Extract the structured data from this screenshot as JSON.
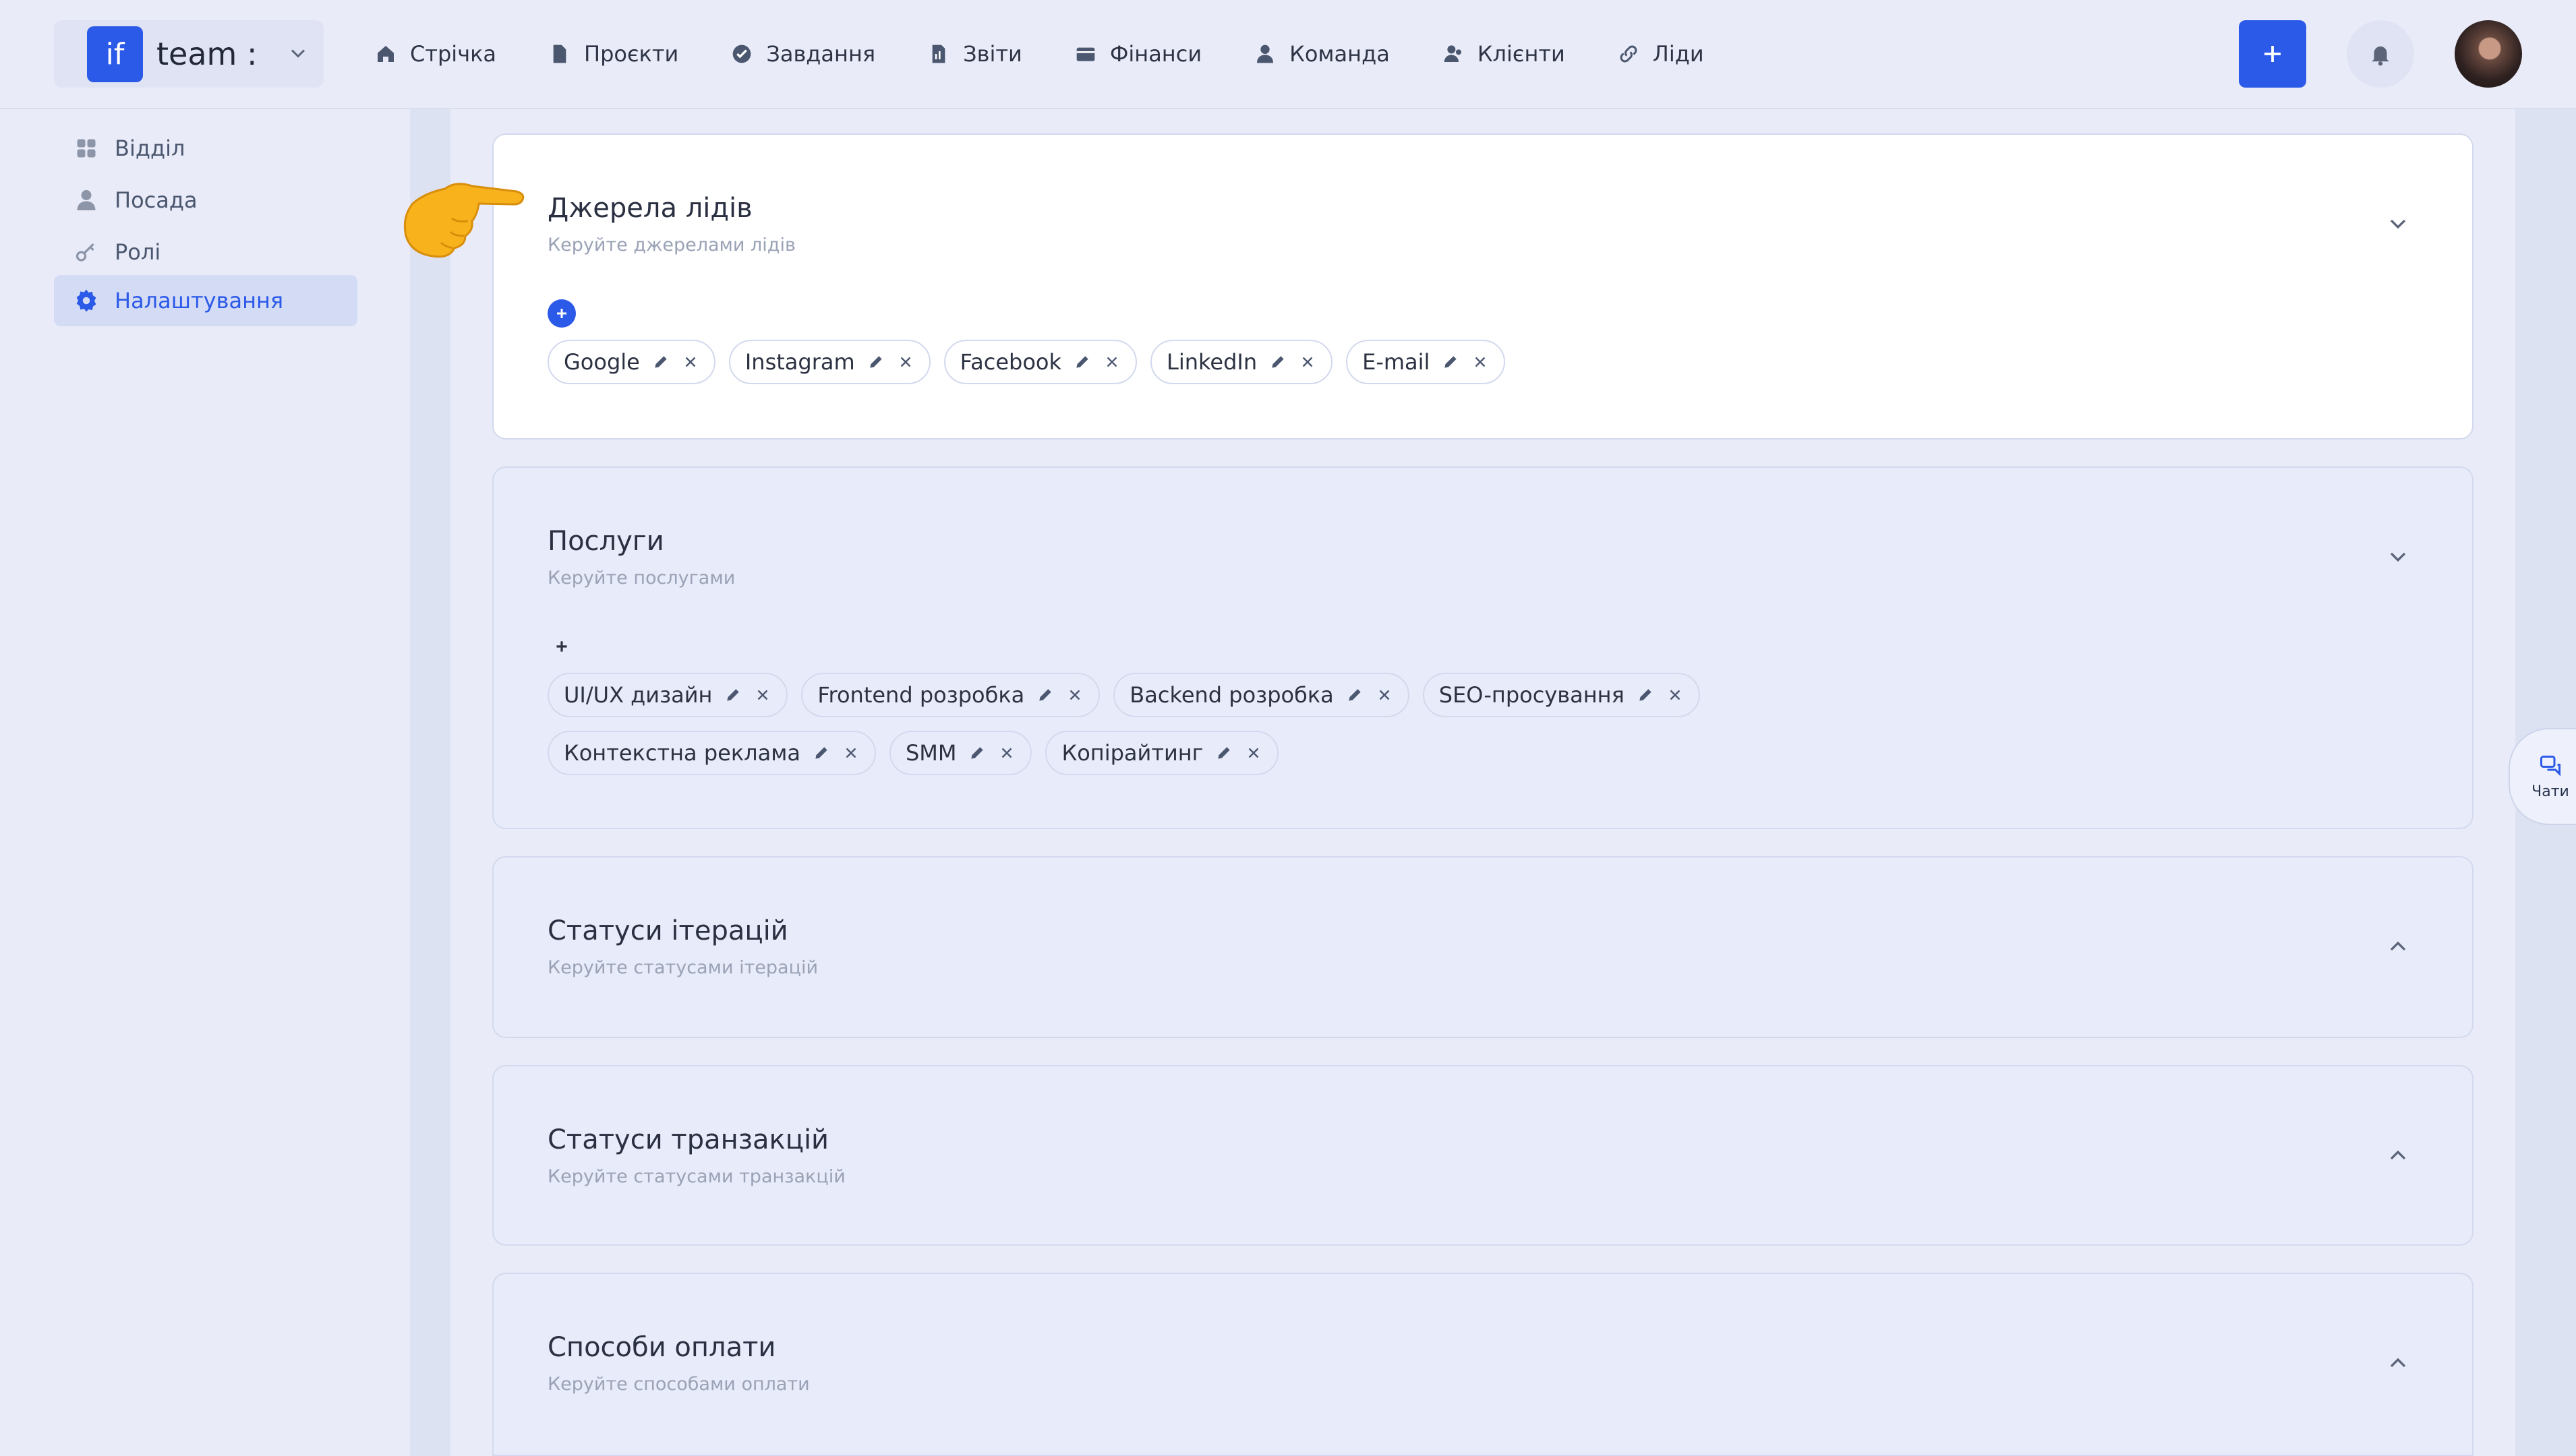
{
  "brand": {
    "logo_text": "if",
    "name": "team :"
  },
  "nav": [
    {
      "label": "Стрічка",
      "icon": "home-icon"
    },
    {
      "label": "Проєкти",
      "icon": "document-icon"
    },
    {
      "label": "Завдання",
      "icon": "check-circle-icon"
    },
    {
      "label": "Звіти",
      "icon": "report-icon"
    },
    {
      "label": "Фінанси",
      "icon": "wallet-icon"
    },
    {
      "label": "Команда",
      "icon": "user-icon"
    },
    {
      "label": "Клієнти",
      "icon": "users-icon"
    },
    {
      "label": "Ліди",
      "icon": "link-icon"
    }
  ],
  "sidebar": {
    "items": [
      {
        "label": "Відділ",
        "icon": "grid-icon"
      },
      {
        "label": "Посада",
        "icon": "user-icon"
      },
      {
        "label": "Ролі",
        "icon": "key-icon"
      },
      {
        "label": "Налаштування",
        "icon": "gear-icon",
        "active": true
      }
    ]
  },
  "sections": [
    {
      "title": "Джерела лідів",
      "subtitle": "Керуйте джерелами лідів",
      "expanded": true,
      "rows": [
        [
          "Google",
          "Instagram",
          "Facebook",
          "LinkedIn",
          "E-mail"
        ]
      ]
    },
    {
      "title": "Послуги",
      "subtitle": "Керуйте послугами",
      "expanded": true,
      "rows": [
        [
          "UI/UX дизайн",
          "Frontend розробка",
          "Backend розробка",
          "SEO-просування"
        ],
        [
          "Контекстна реклама",
          "SMM",
          "Копірайтинг"
        ]
      ]
    },
    {
      "title": "Статуси ітерацій",
      "subtitle": "Керуйте статусами ітерацій",
      "expanded": false
    },
    {
      "title": "Статуси транзакцій",
      "subtitle": "Керуйте статусами транзакцій",
      "expanded": false
    },
    {
      "title": "Способи оплати",
      "subtitle": "Керуйте способами оплати",
      "expanded": false
    }
  ],
  "chat": {
    "label": "Чати"
  },
  "colors": {
    "accent": "#2b59e8",
    "background": "#e9ecf8",
    "card": "#ffffff"
  }
}
